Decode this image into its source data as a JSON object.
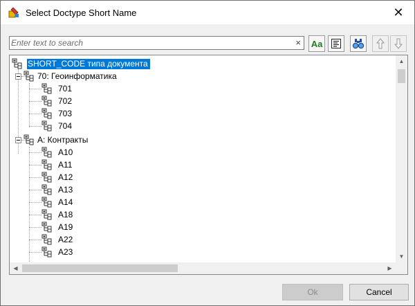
{
  "window": {
    "title": "Select Doctype Short Name",
    "close_glyph": "✕"
  },
  "search": {
    "placeholder": "Enter text to search",
    "value": "",
    "clear_glyph": "×"
  },
  "toolbar": {
    "match_case_label": "Aa",
    "buttons": [
      "match-case-icon",
      "whole-word-icon",
      "find-binoculars-icon",
      "move-up-icon",
      "move-down-icon"
    ]
  },
  "tree": {
    "root": "SHORT_CODE типа документа",
    "groups": [
      {
        "label": "70: Геоинформатика",
        "children": [
          "701",
          "702",
          "703",
          "704"
        ]
      },
      {
        "label": "A: Контракты",
        "children": [
          "A10",
          "A11",
          "A12",
          "A13",
          "A14",
          "A18",
          "A19",
          "A22",
          "A23"
        ]
      }
    ]
  },
  "buttons": {
    "ok": "Ok",
    "cancel": "Cancel"
  },
  "colors": {
    "selection": "#0078d7",
    "accent_green": "#1e7b1e"
  }
}
